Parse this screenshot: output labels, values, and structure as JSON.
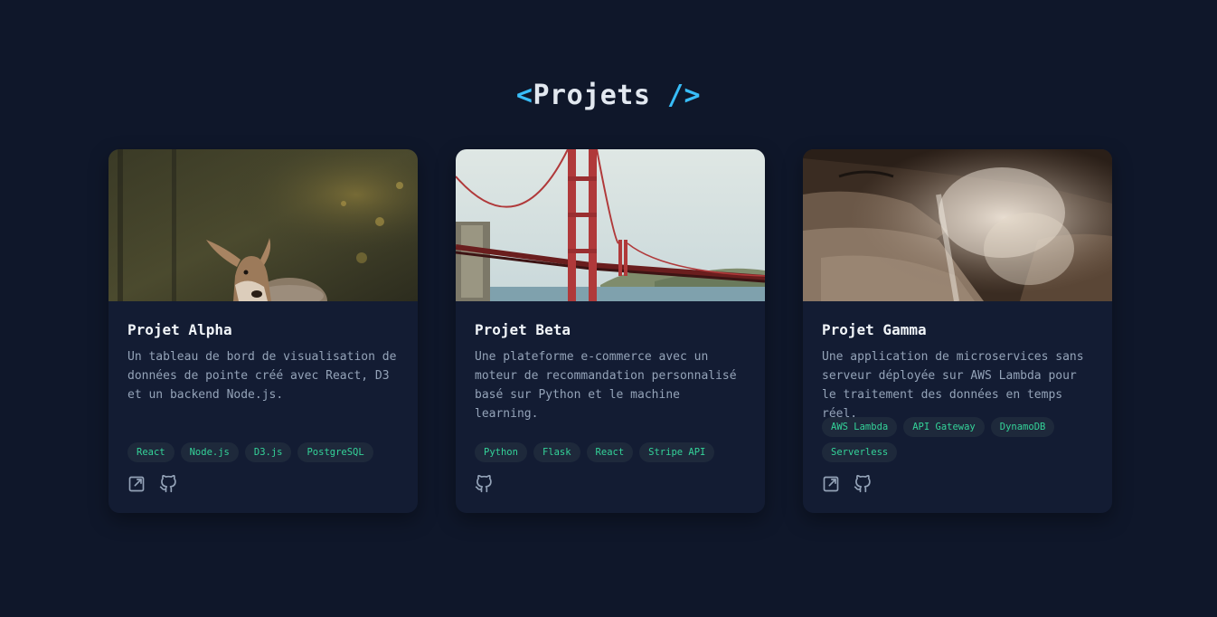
{
  "section": {
    "heading_open": "<",
    "heading_text": "Projets",
    "heading_close": " />"
  },
  "projects": [
    {
      "title": "Projet Alpha",
      "description": "Un tableau de bord de visualisation de données de pointe créé avec React, D3 et un backend Node.js.",
      "image": "deer-in-forest",
      "tags": [
        "React",
        "Node.js",
        "D3.js",
        "PostgreSQL"
      ],
      "links": [
        "external-link-icon",
        "github-icon"
      ]
    },
    {
      "title": "Projet Beta",
      "description": "Une plateforme e-commerce avec un moteur de recommandation personnalisé basé sur Python et le machine learning.",
      "image": "golden-gate-bridge",
      "tags": [
        "Python",
        "Flask",
        "React",
        "Stripe API"
      ],
      "links": [
        "github-icon"
      ]
    },
    {
      "title": "Projet Gamma",
      "description": "Une application de microservices sans serveur déployée sur AWS Lambda pour le traitement des données en temps réel.",
      "image": "waterfall-mist",
      "tags": [
        "AWS Lambda",
        "API Gateway",
        "DynamoDB",
        "Serverless"
      ],
      "links": [
        "external-link-icon",
        "github-icon"
      ]
    }
  ],
  "colors": {
    "background": "#0f172a",
    "card": "#131c33",
    "accent": "#38bdf8",
    "tag_text": "#34d399",
    "tag_bg": "#1e293b",
    "muted_text": "#94a3b8"
  }
}
